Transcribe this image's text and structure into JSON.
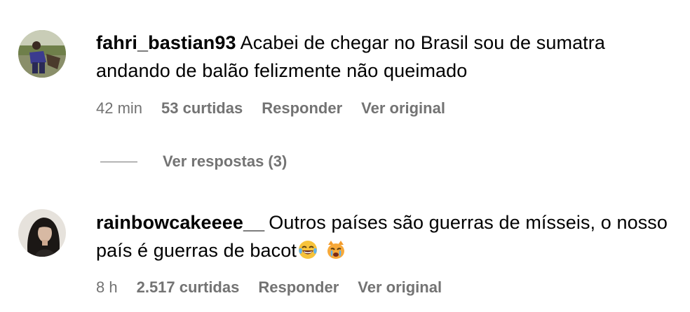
{
  "comments": [
    {
      "username": "fahri_bastian93",
      "text": "Acabei de chegar no Brasil sou de sumatra andando de balão felizmente não queimado",
      "time": "42 min",
      "likes": "53 curtidas",
      "reply_label": "Responder",
      "translate_label": "Ver original",
      "view_replies_label": "Ver respostas (3)"
    },
    {
      "username": "rainbowcakeeee__",
      "text": "Outros países são guerras de mísseis, o nosso país é guerras de bacot",
      "emojis": [
        "face-with-tears-of-joy-icon",
        "crying-cat-face-icon"
      ],
      "time": "8 h",
      "likes": "2.517 curtidas",
      "reply_label": "Responder",
      "translate_label": "Ver original"
    }
  ]
}
